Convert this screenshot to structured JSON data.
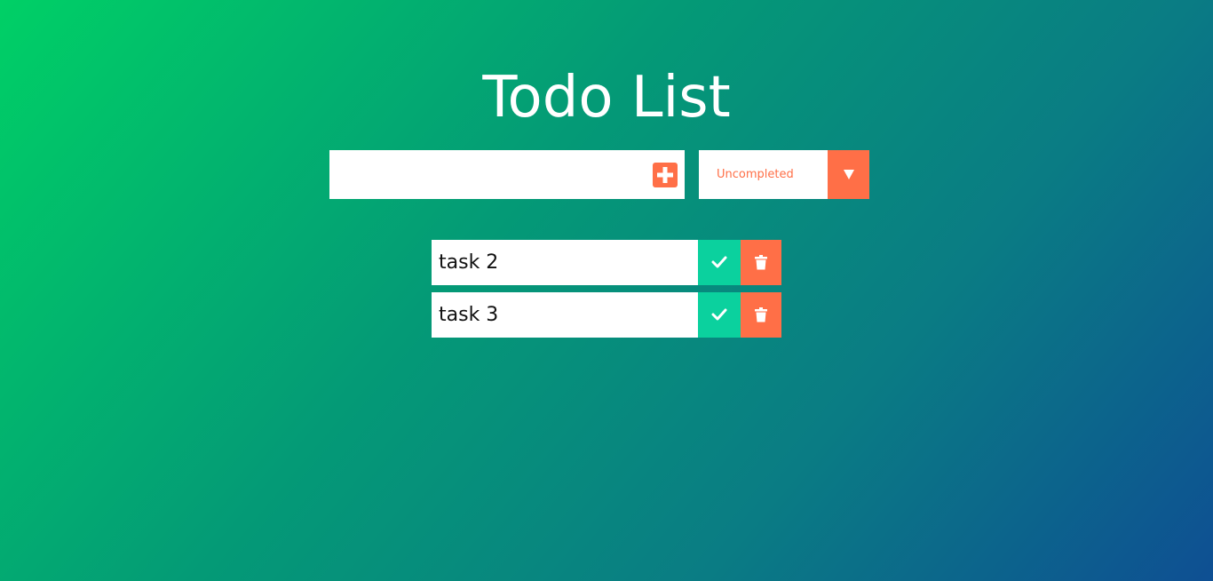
{
  "header": {
    "title": "Todo List"
  },
  "form": {
    "input_value": "",
    "input_placeholder": "",
    "add_icon": "plus-square-icon",
    "filter": {
      "selected": "Uncompleted",
      "arrow_icon": "caret-down-icon"
    }
  },
  "todos": [
    {
      "text": "task 2",
      "complete_icon": "check-icon",
      "delete_icon": "trash-icon"
    },
    {
      "text": "task 3",
      "complete_icon": "check-icon",
      "delete_icon": "trash-icon"
    }
  ],
  "colors": {
    "accent": "#ff6f47",
    "complete": "#0bd19e",
    "gradient_start": "#00d066",
    "gradient_end": "#0e4f93"
  }
}
